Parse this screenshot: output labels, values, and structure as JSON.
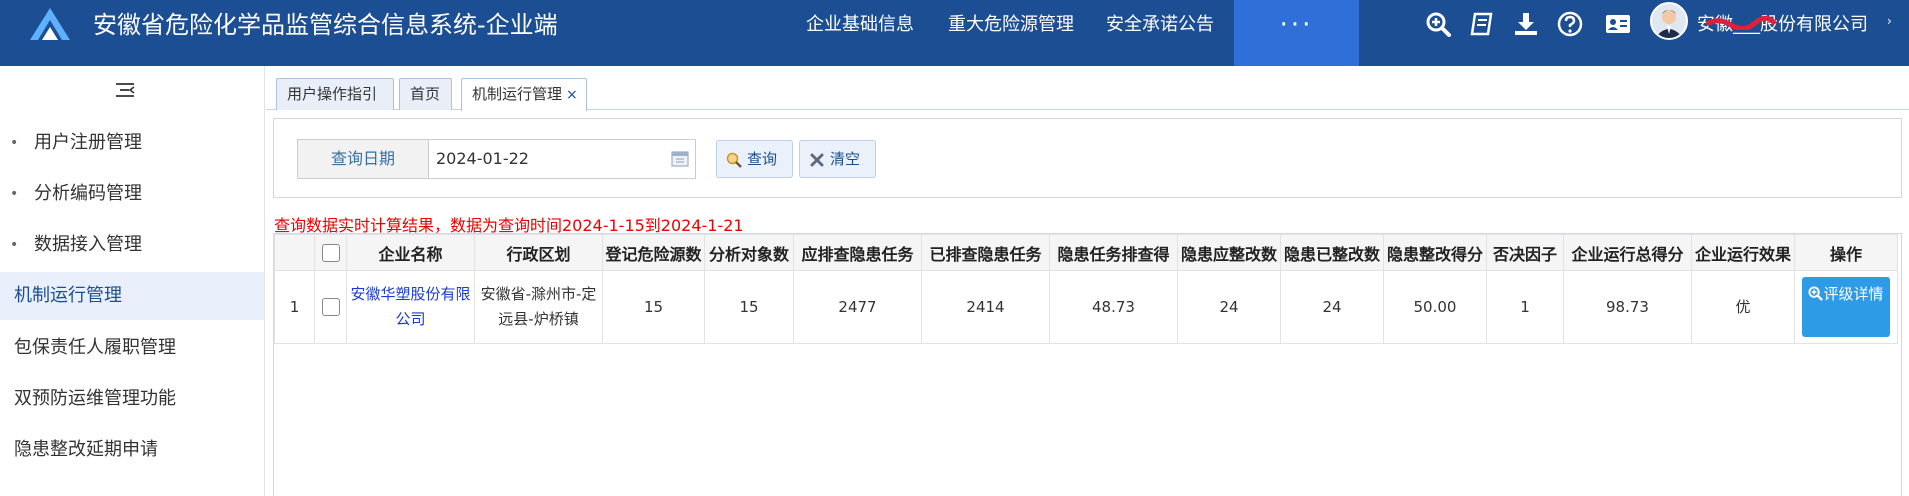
{
  "header": {
    "title": "安徽省危险化学品监管综合信息系统-企业端",
    "nav": [
      "企业基础信息",
      "重大危险源管理",
      "安全承诺公告"
    ],
    "more_label": "···",
    "user": "安徽___股份有限公司",
    "icons": [
      "zoom-in-icon",
      "book-icon",
      "download-icon",
      "help-icon",
      "id-card-icon"
    ],
    "colors": {
      "bar": "#1c4e93",
      "more_bg": "#2f6fd8"
    }
  },
  "sidebar": {
    "items": [
      {
        "label": "用户注册管理",
        "bullet": "•"
      },
      {
        "label": "分析编码管理",
        "bullet": "•"
      },
      {
        "label": "数据接入管理",
        "bullet": "•"
      },
      {
        "label": "机制运行管理",
        "bullet": ""
      },
      {
        "label": "包保责任人履职管理",
        "bullet": ""
      },
      {
        "label": "双预防运维管理功能",
        "bullet": ""
      },
      {
        "label": "隐患整改延期申请",
        "bullet": ""
      }
    ],
    "active_index": 3
  },
  "tabs": [
    {
      "label": "用户操作指引"
    },
    {
      "label": "首页"
    },
    {
      "label": "机制运行管理",
      "close": "×"
    }
  ],
  "search": {
    "date_label": "查询日期",
    "date_value": "2024-01-22",
    "query_label": "查询",
    "clear_label": "清空"
  },
  "notice": "查询数据实时计算结果，数据为查询时间2024-1-15到2024-1-21",
  "table": {
    "headers": [
      "",
      "",
      "企业名称",
      "行政区划",
      "登记危险源数",
      "分析对象数",
      "应排查隐患任务",
      "已排查隐患任务",
      "隐患任务排查得",
      "隐患应整改数",
      "隐患已整改数",
      "隐患整改得分",
      "否决因子",
      "企业运行总得分",
      "企业运行效果",
      "操作"
    ],
    "rows": [
      {
        "index": "1",
        "name": "安徽华塑股份有限公司",
        "region": "安徽省-滁州市-定远县-炉桥镇",
        "values": [
          "15",
          "15",
          "2477",
          "2414",
          "48.73",
          "24",
          "24",
          "50.00",
          "1",
          "98.73",
          "优"
        ],
        "action": "评级详情"
      }
    ]
  }
}
